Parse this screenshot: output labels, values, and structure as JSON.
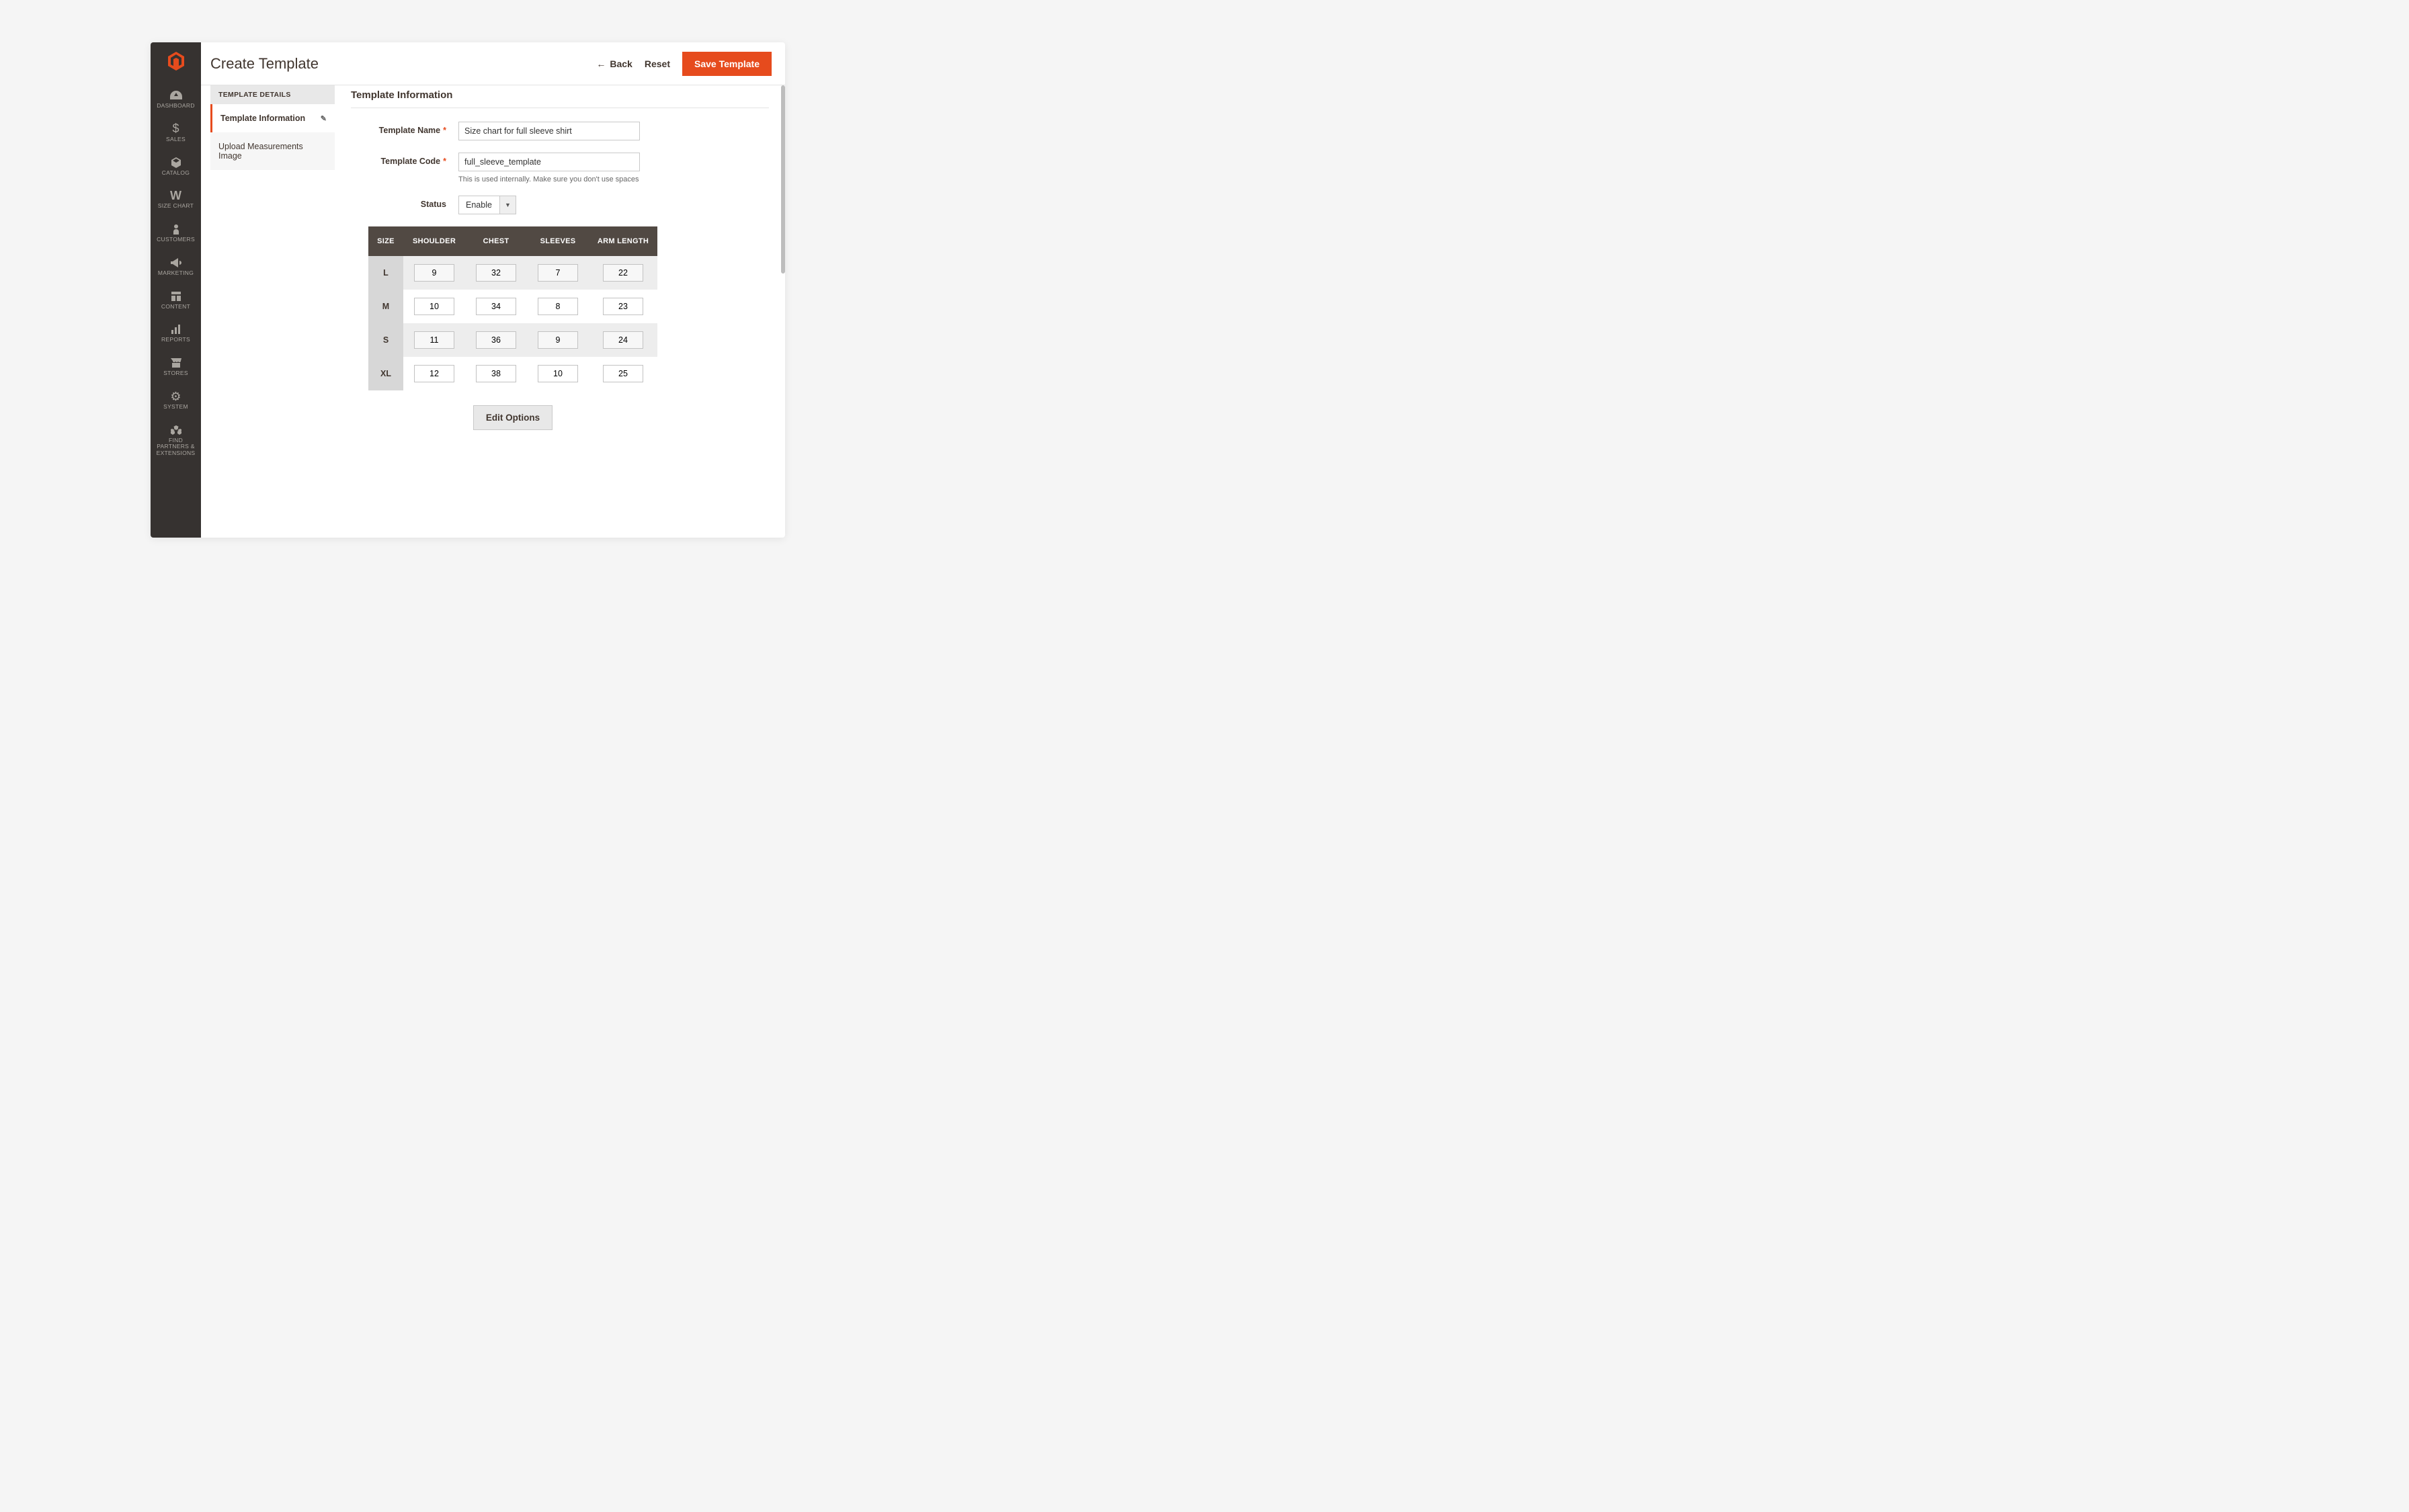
{
  "colors": {
    "accent": "#e64b1d",
    "sidebar_bg": "#363230",
    "table_head": "#514943"
  },
  "sidebar": {
    "items": [
      {
        "key": "dashboard",
        "label": "DASHBOARD",
        "icon": "gauge"
      },
      {
        "key": "sales",
        "label": "SALES",
        "icon": "dollar"
      },
      {
        "key": "catalog",
        "label": "CATALOG",
        "icon": "cube"
      },
      {
        "key": "sizechart",
        "label": "SIZE CHART",
        "icon": "w"
      },
      {
        "key": "customers",
        "label": "CUSTOMERS",
        "icon": "person"
      },
      {
        "key": "marketing",
        "label": "MARKETING",
        "icon": "megaphone"
      },
      {
        "key": "content",
        "label": "CONTENT",
        "icon": "layout"
      },
      {
        "key": "reports",
        "label": "REPORTS",
        "icon": "bars"
      },
      {
        "key": "stores",
        "label": "STORES",
        "icon": "storefront"
      },
      {
        "key": "system",
        "label": "SYSTEM",
        "icon": "gear"
      },
      {
        "key": "partners",
        "label": "FIND PARTNERS & EXTENSIONS",
        "icon": "boxes"
      }
    ]
  },
  "header": {
    "title": "Create Template",
    "back": "Back",
    "reset": "Reset",
    "save": "Save Template"
  },
  "tabs": {
    "group_title": "TEMPLATE DETAILS",
    "items": [
      {
        "label": "Template Information",
        "active": true,
        "editable": true
      },
      {
        "label": "Upload Measurements Image",
        "active": false,
        "editable": false
      }
    ]
  },
  "section": {
    "title": "Template Information"
  },
  "form": {
    "template_name": {
      "label": "Template Name",
      "value": "Size chart for full sleeve shirt",
      "required": true
    },
    "template_code": {
      "label": "Template Code",
      "value": "full_sleeve_template",
      "required": true,
      "hint": "This is used internally. Make sure you don't use spaces"
    },
    "status": {
      "label": "Status",
      "value": "Enable"
    }
  },
  "table": {
    "headers": [
      "SIZE",
      "SHOULDER",
      "CHEST",
      "SLEEVES",
      "ARM LENGTH"
    ],
    "rows": [
      {
        "size": "L",
        "cells": [
          "9",
          "32",
          "7",
          "22"
        ]
      },
      {
        "size": "M",
        "cells": [
          "10",
          "34",
          "8",
          "23"
        ]
      },
      {
        "size": "S",
        "cells": [
          "11",
          "36",
          "9",
          "24"
        ]
      },
      {
        "size": "XL",
        "cells": [
          "12",
          "38",
          "10",
          "25"
        ]
      }
    ]
  },
  "buttons": {
    "edit_options": "Edit Options"
  },
  "icons": {
    "gauge": "◐",
    "dollar": "$",
    "cube": "⬢",
    "w": "W",
    "person": "●",
    "megaphone": "◀",
    "layout": "▦",
    "bars": "▮",
    "storefront": "⌂",
    "gear": "⚙",
    "boxes": "▣",
    "back_arrow": "←",
    "dropdown": "▼",
    "pencil_glyph": "✎"
  }
}
